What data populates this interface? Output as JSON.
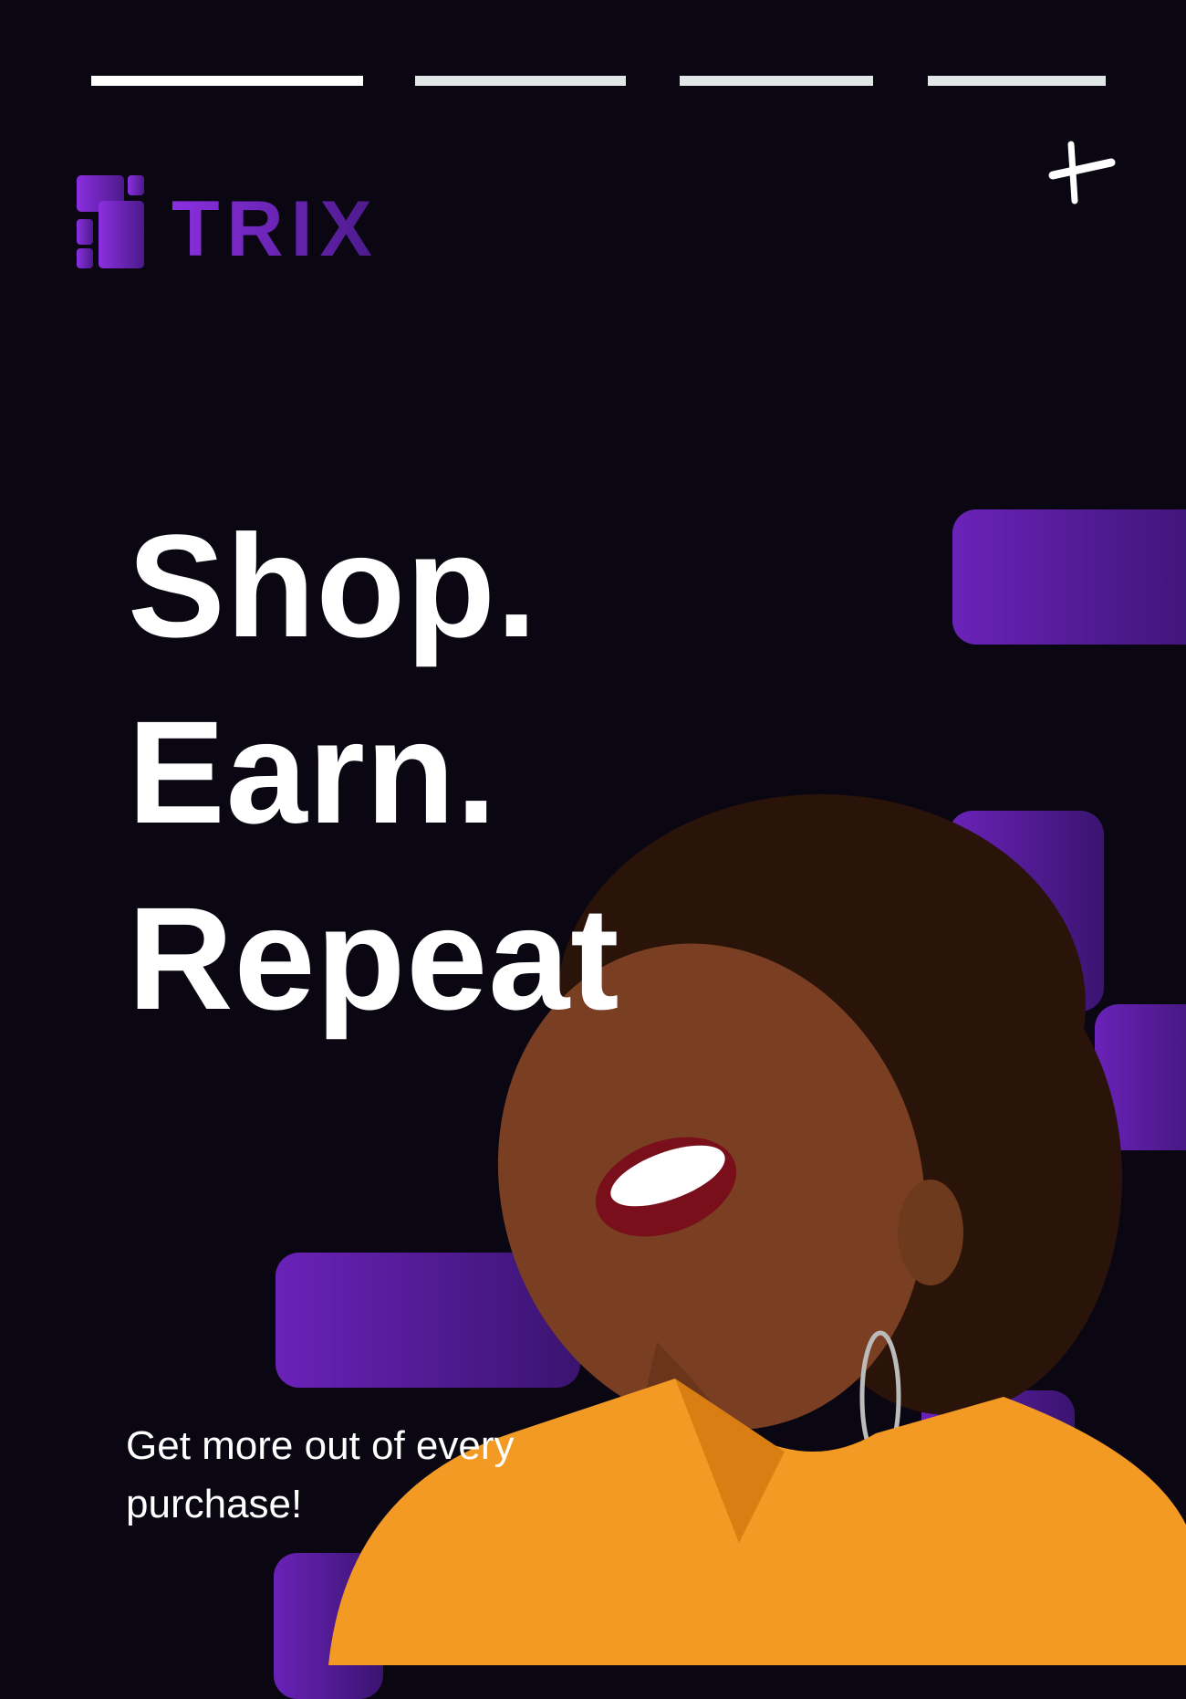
{
  "story_progress": {
    "segments": 4,
    "active_index": 0
  },
  "close_icon": "close-icon",
  "logo": {
    "text": "TRIX"
  },
  "headline": {
    "line1": "Shop.",
    "line2": "Earn.",
    "line3": "Repeat"
  },
  "subtitle": "Get more out of every purchase!",
  "colors": {
    "background": "#0a0713",
    "accent": "#7b2fd6",
    "shirt": "#f39a25"
  }
}
